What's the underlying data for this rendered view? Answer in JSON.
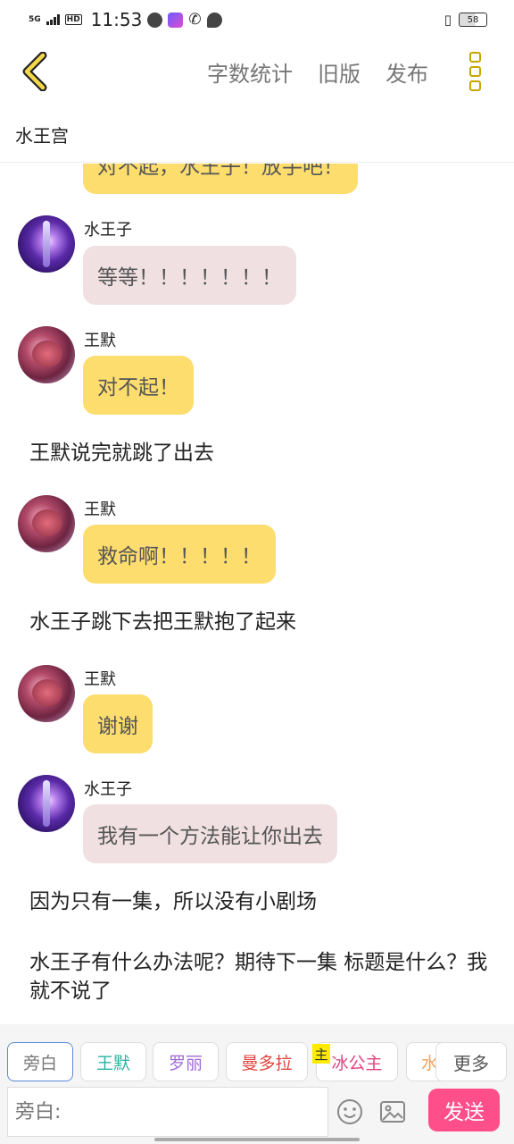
{
  "status_bar": {
    "network": "5G",
    "hd": "HD",
    "time": "11:53",
    "battery": "58"
  },
  "header": {
    "actions": [
      "字数统计",
      "旧版",
      "发布"
    ],
    "room_title": "水王宫"
  },
  "colors": {
    "accent_yellow": "#fddd6e",
    "bubble_pink": "#f0e0e2",
    "send_button": "#ff4f8b",
    "back_arrow": "#c8a400"
  },
  "messages": [
    {
      "type": "bubble",
      "text": "对不起，水王子！放手吧！",
      "color": "yellow"
    },
    {
      "type": "bubble",
      "sender": "水王子",
      "text": "等等！！！！！！！",
      "color": "pink"
    },
    {
      "type": "bubble",
      "sender": "王默",
      "text": "对不起！",
      "color": "yellow"
    },
    {
      "type": "narration",
      "text": "王默说完就跳了出去"
    },
    {
      "type": "bubble",
      "sender": "王默",
      "text": "救命啊！！！！！",
      "color": "yellow"
    },
    {
      "type": "narration",
      "text": "水王子跳下去把王默抱了起来"
    },
    {
      "type": "bubble",
      "sender": "王默",
      "text": "谢谢",
      "color": "yellow"
    },
    {
      "type": "bubble",
      "sender": "水王子",
      "text": "我有一个方法能让你出去",
      "color": "pink"
    },
    {
      "type": "narration",
      "text": "因为只有一集，所以没有小剧场"
    },
    {
      "type": "narration",
      "text": "水王子有什么办法呢？期待下一集 标题是什么？我就不说了"
    }
  ],
  "roles": [
    {
      "label": "旁白",
      "color": "#777777",
      "active": true
    },
    {
      "label": "王默",
      "color": "#2bb3a3"
    },
    {
      "label": "罗丽",
      "color": "#a06ad8"
    },
    {
      "label": "曼多拉",
      "color": "#e0453f"
    },
    {
      "label": "冰公主",
      "color": "#e0457f",
      "tag": "主"
    },
    {
      "label": "水",
      "color": "#f0a060"
    }
  ],
  "more_roles_label": "更多",
  "input": {
    "placeholder": "旁白:"
  },
  "send_label": "发送"
}
